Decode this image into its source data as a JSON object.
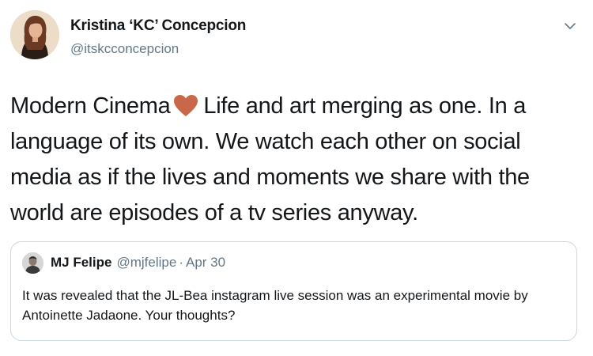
{
  "author": {
    "display_name": "Kristina ‘KC’ Concepcion",
    "handle": "@itskcconcepcion",
    "avatar_icon": "profile-photo"
  },
  "menu_icon": "chevron-down-icon",
  "tweet": {
    "text_before_emoji": "Modern Cinema",
    "emoji": "heart",
    "emoji_color": "#c8674a",
    "text_after_emoji": "Life and art merging as one. In a language of its own. We watch each other on social media as if the lives and moments we share with the world are episodes of a tv series anyway."
  },
  "quoted_tweet": {
    "display_name": "MJ Felipe",
    "handle": "@mjfelipe",
    "separator": "·",
    "date": "Apr 30",
    "text": "It was revealed that the JL-Bea instagram live session was an experimental movie by Antoinette Jadaone. Your thoughts?",
    "avatar_icon": "profile-photo"
  },
  "colors": {
    "primary_text": "#14171a",
    "secondary_text": "#657786",
    "border": "#ccd6dd"
  }
}
